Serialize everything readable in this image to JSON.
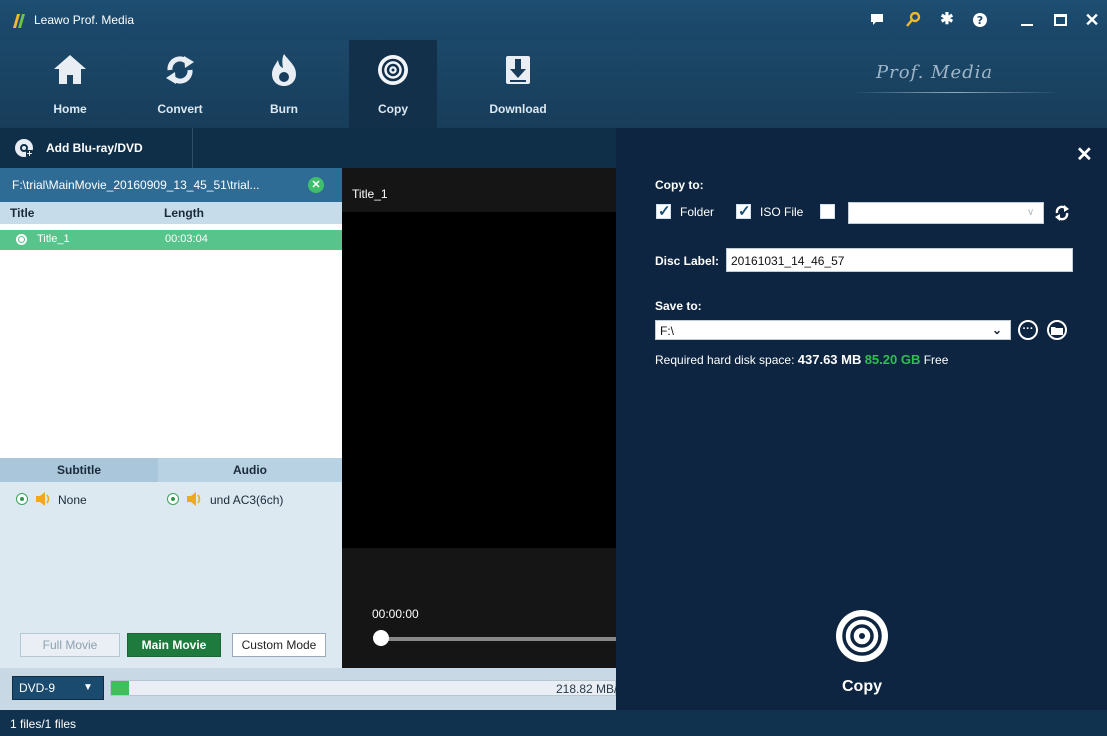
{
  "app": {
    "title": "Leawo Prof. Media",
    "brand": "Prof. Media"
  },
  "titlebar": {
    "icons": [
      "feedback-icon",
      "key-icon",
      "settings-icon",
      "help-icon",
      "minimize-icon",
      "maximize-icon",
      "close-icon"
    ]
  },
  "nav": [
    {
      "label": "Home",
      "icon": "home-icon"
    },
    {
      "label": "Convert",
      "icon": "convert-icon"
    },
    {
      "label": "Burn",
      "icon": "burn-icon"
    },
    {
      "label": "Copy",
      "icon": "copy-icon",
      "active": true
    },
    {
      "label": "Download",
      "icon": "download-icon"
    }
  ],
  "subbar": {
    "add_label": "Add Blu-ray/DVD"
  },
  "file": {
    "path": "F:\\trial\\MainMovie_20160909_13_45_51\\trial..."
  },
  "titles": {
    "headers": {
      "title": "Title",
      "length": "Length"
    },
    "rows": [
      {
        "title": "Title_1",
        "length": "00:03:04",
        "selected": true
      }
    ]
  },
  "tracks": {
    "subtitle_header": "Subtitle",
    "audio_header": "Audio",
    "subtitle_value": "None",
    "audio_value": "und AC3(6ch)"
  },
  "modes": {
    "full": "Full Movie",
    "main": "Main Movie",
    "custom": "Custom Mode",
    "active": "main"
  },
  "disc": {
    "type": "DVD-9",
    "size_text": "218.82 MB/",
    "fill_fraction": 0.035
  },
  "status": {
    "text": "1 files/1 files"
  },
  "player": {
    "title": "Title_1",
    "time": "00:00:00"
  },
  "copy_panel": {
    "copy_to_label": "Copy to:",
    "folder_label": "Folder",
    "folder_checked": true,
    "iso_label": "ISO File",
    "iso_checked": true,
    "disc_checked": false,
    "disc_value": "",
    "disc_label_label": "Disc Label:",
    "disc_label_value": "20161031_14_46_57",
    "save_to_label": "Save to:",
    "save_to_value": "F:\\",
    "space_prefix": "Required hard disk space:",
    "space_required": "437.63 MB",
    "space_free": "85.20 GB",
    "space_suffix": "Free",
    "copy_button": "Copy"
  },
  "colors": {
    "accent_green": "#3fbf6c",
    "free_space": "#2fbf4f",
    "active_mode": "#1f7a3d"
  }
}
